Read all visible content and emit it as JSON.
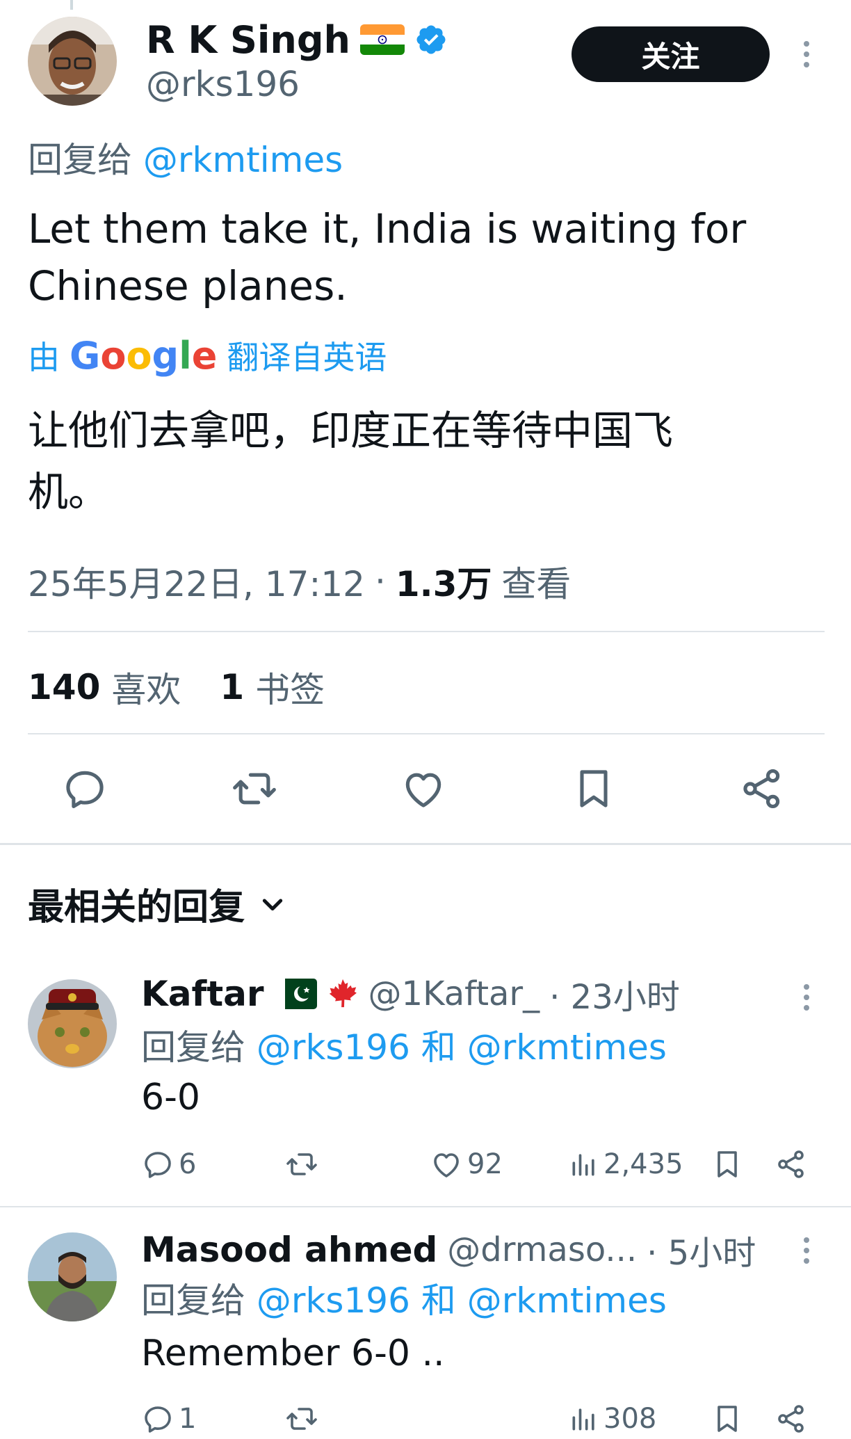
{
  "tweet": {
    "author_name": "R K Singh",
    "author_handle": "@rks196",
    "follow_label": "关注",
    "reply_prefix": "回复给",
    "reply_to": "@rkmtimes",
    "text": "Let them take it, India is waiting for Chinese planes.",
    "translate_by": "由",
    "translate_brand": "Google",
    "translate_suffix": "翻译自英语",
    "translated_text": "让他们去拿吧，印度正在等待中国飞机。",
    "timestamp": "25年5月22日, 17:12",
    "views_count": "1.3万",
    "views_label": "查看",
    "likes_count": "140",
    "likes_label": "喜欢",
    "bookmarks_count": "1",
    "bookmarks_label": "书签"
  },
  "replies_header": {
    "label": "最相关的回复"
  },
  "replies": [
    {
      "name": "Kaftar",
      "handle": "@1Kaftar_",
      "time": "· 23小时",
      "reply_prefix": "回复给",
      "reply_to": "@rks196 和 @rkmtimes",
      "text": "6-0",
      "comments": "6",
      "likes": "92",
      "views": "2,435"
    },
    {
      "name": "Masood ahmed",
      "handle": "@drmaso...",
      "time": "· 5小时",
      "reply_prefix": "回复给",
      "reply_to": "@rks196 和 @rkmtimes",
      "text": "Remember 6-0 ..",
      "comments": "1",
      "likes": "",
      "views": "308"
    }
  ],
  "icons": [
    "verified-badge-icon",
    "more-icon",
    "reply-icon",
    "retweet-icon",
    "like-icon",
    "bookmark-icon",
    "share-icon",
    "views-icon",
    "chevron-down-icon"
  ],
  "colors": {
    "link": "#1d9bf0",
    "text": "#0f1419",
    "muted": "#536471",
    "verified": "#1d9bf0"
  }
}
